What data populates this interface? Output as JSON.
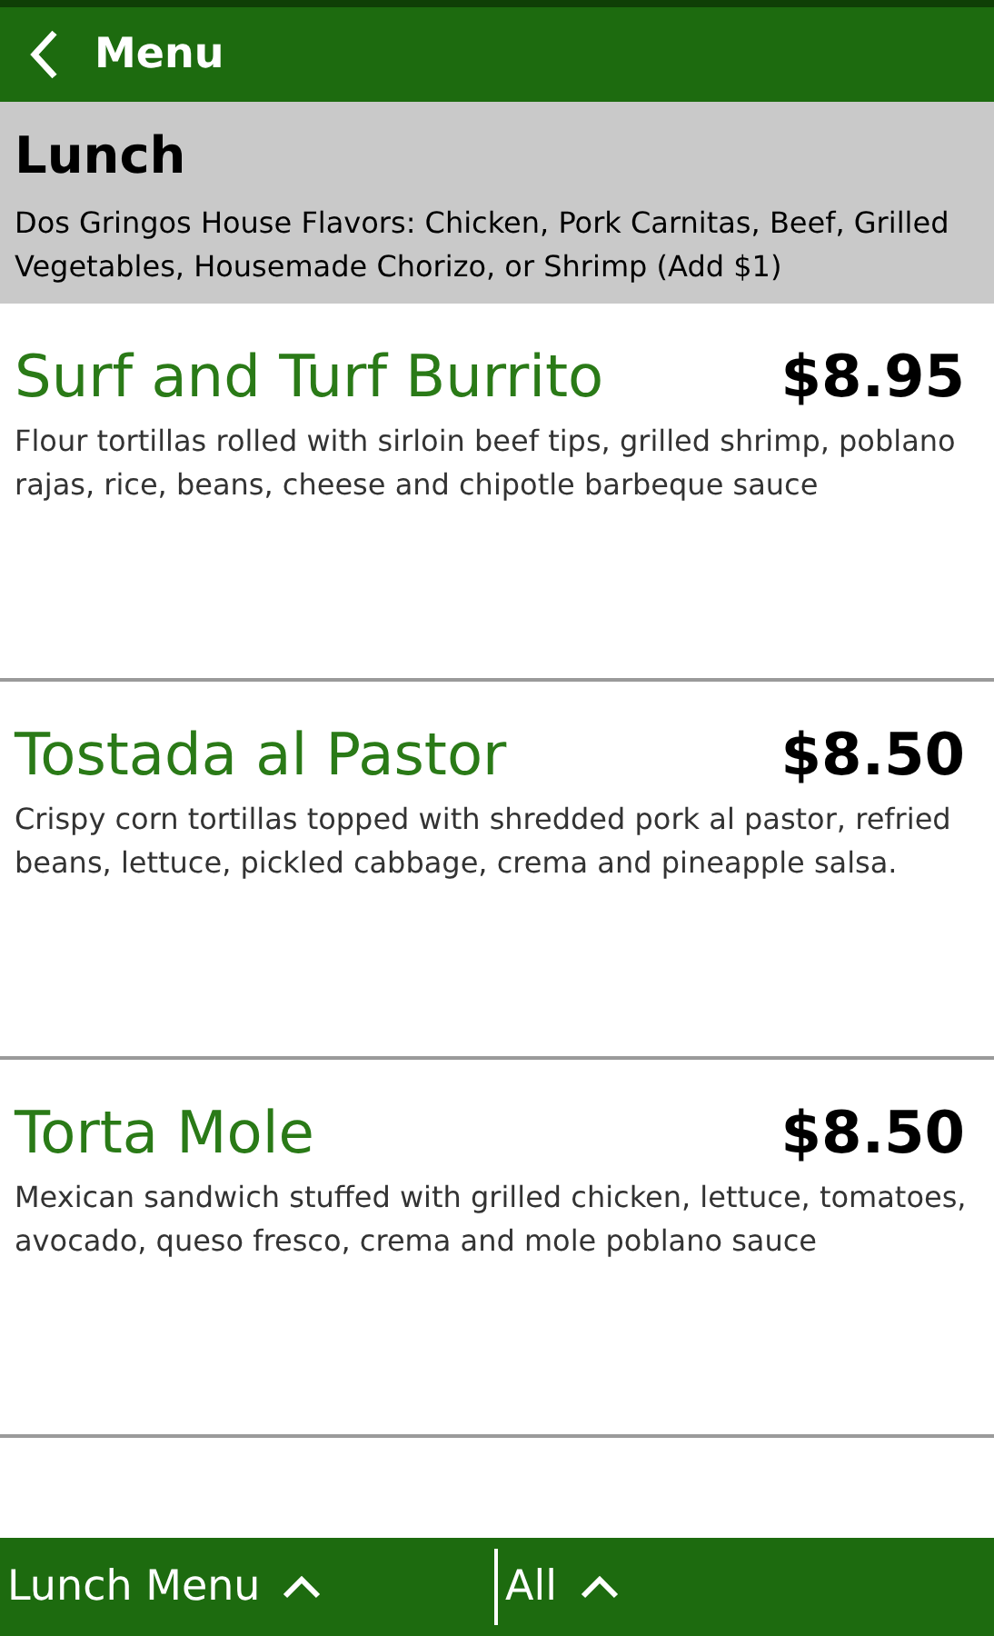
{
  "header": {
    "title": "Menu"
  },
  "section": {
    "title": "Lunch",
    "description": "Dos Gringos House Flavors: Chicken, Pork Carnitas, Beef, Grilled Vegetables, Housemade Chorizo, or Shrimp (Add $1)"
  },
  "items": [
    {
      "name": "Surf and Turf Burrito",
      "price": "$8.95",
      "description": "Flour tortillas rolled with sirloin beef tips, grilled shrimp, poblano rajas, rice, beans, cheese and chipotle barbeque sauce"
    },
    {
      "name": "Tostada al Pastor",
      "price": "$8.50",
      "description": "Crispy corn tortillas topped with shredded pork al pastor, refried beans, lettuce, pickled cabbage, crema and pineapple salsa."
    },
    {
      "name": "Torta Mole",
      "price": "$8.50",
      "description": "Mexican sandwich stuffed with grilled chicken, lettuce, tomatoes, avocado, queso fresco, crema and mole poblano sauce"
    }
  ],
  "bottom_bar": [
    {
      "label": "Lunch Menu"
    },
    {
      "label": "All"
    }
  ]
}
